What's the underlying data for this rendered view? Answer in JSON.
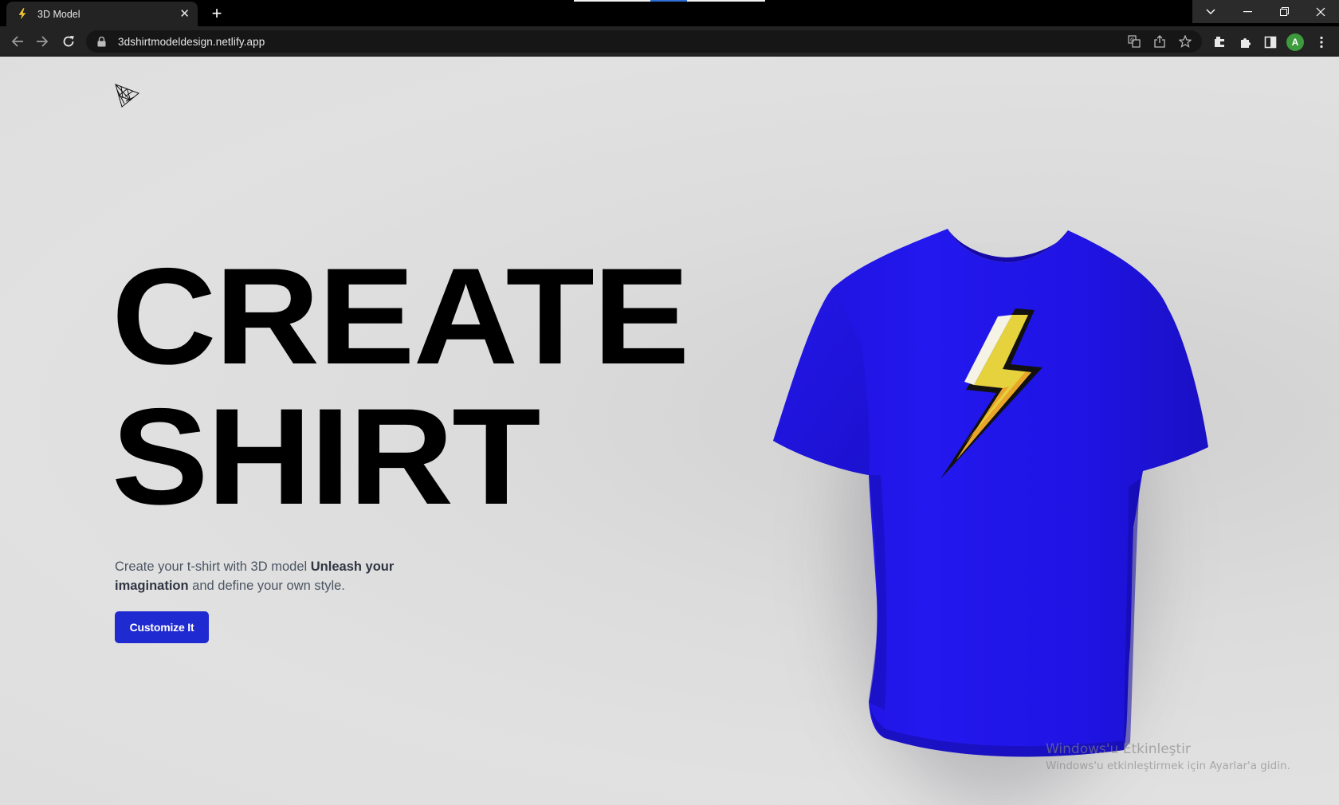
{
  "browser": {
    "tab_title": "3D Model",
    "url": "3dshirtmodeldesign.netlify.app",
    "profile_initial": "A",
    "avatar_color": "#3d9a3d"
  },
  "hero": {
    "headline_line1": "CREATE",
    "headline_line2": "SHIRT",
    "description_plain1": "Create your t-shirt with 3D model ",
    "description_bold": "Unleash your imagination",
    "description_plain2": " and define your own style.",
    "cta_label": "Customize It",
    "cta_color": "#1f2ad0"
  },
  "shirt": {
    "color": "#1f12e6",
    "decal": "lightning-bolt-icon",
    "decal_colors": {
      "outline": "#111111",
      "main": "#e6d23c",
      "shade": "#e9a62a",
      "highlight": "#f5f3e6"
    }
  },
  "watermark": {
    "title": "Windows'u Etkinleştir",
    "subtitle": "Windows'u etkinleştirmek için Ayarlar'a gidin."
  }
}
